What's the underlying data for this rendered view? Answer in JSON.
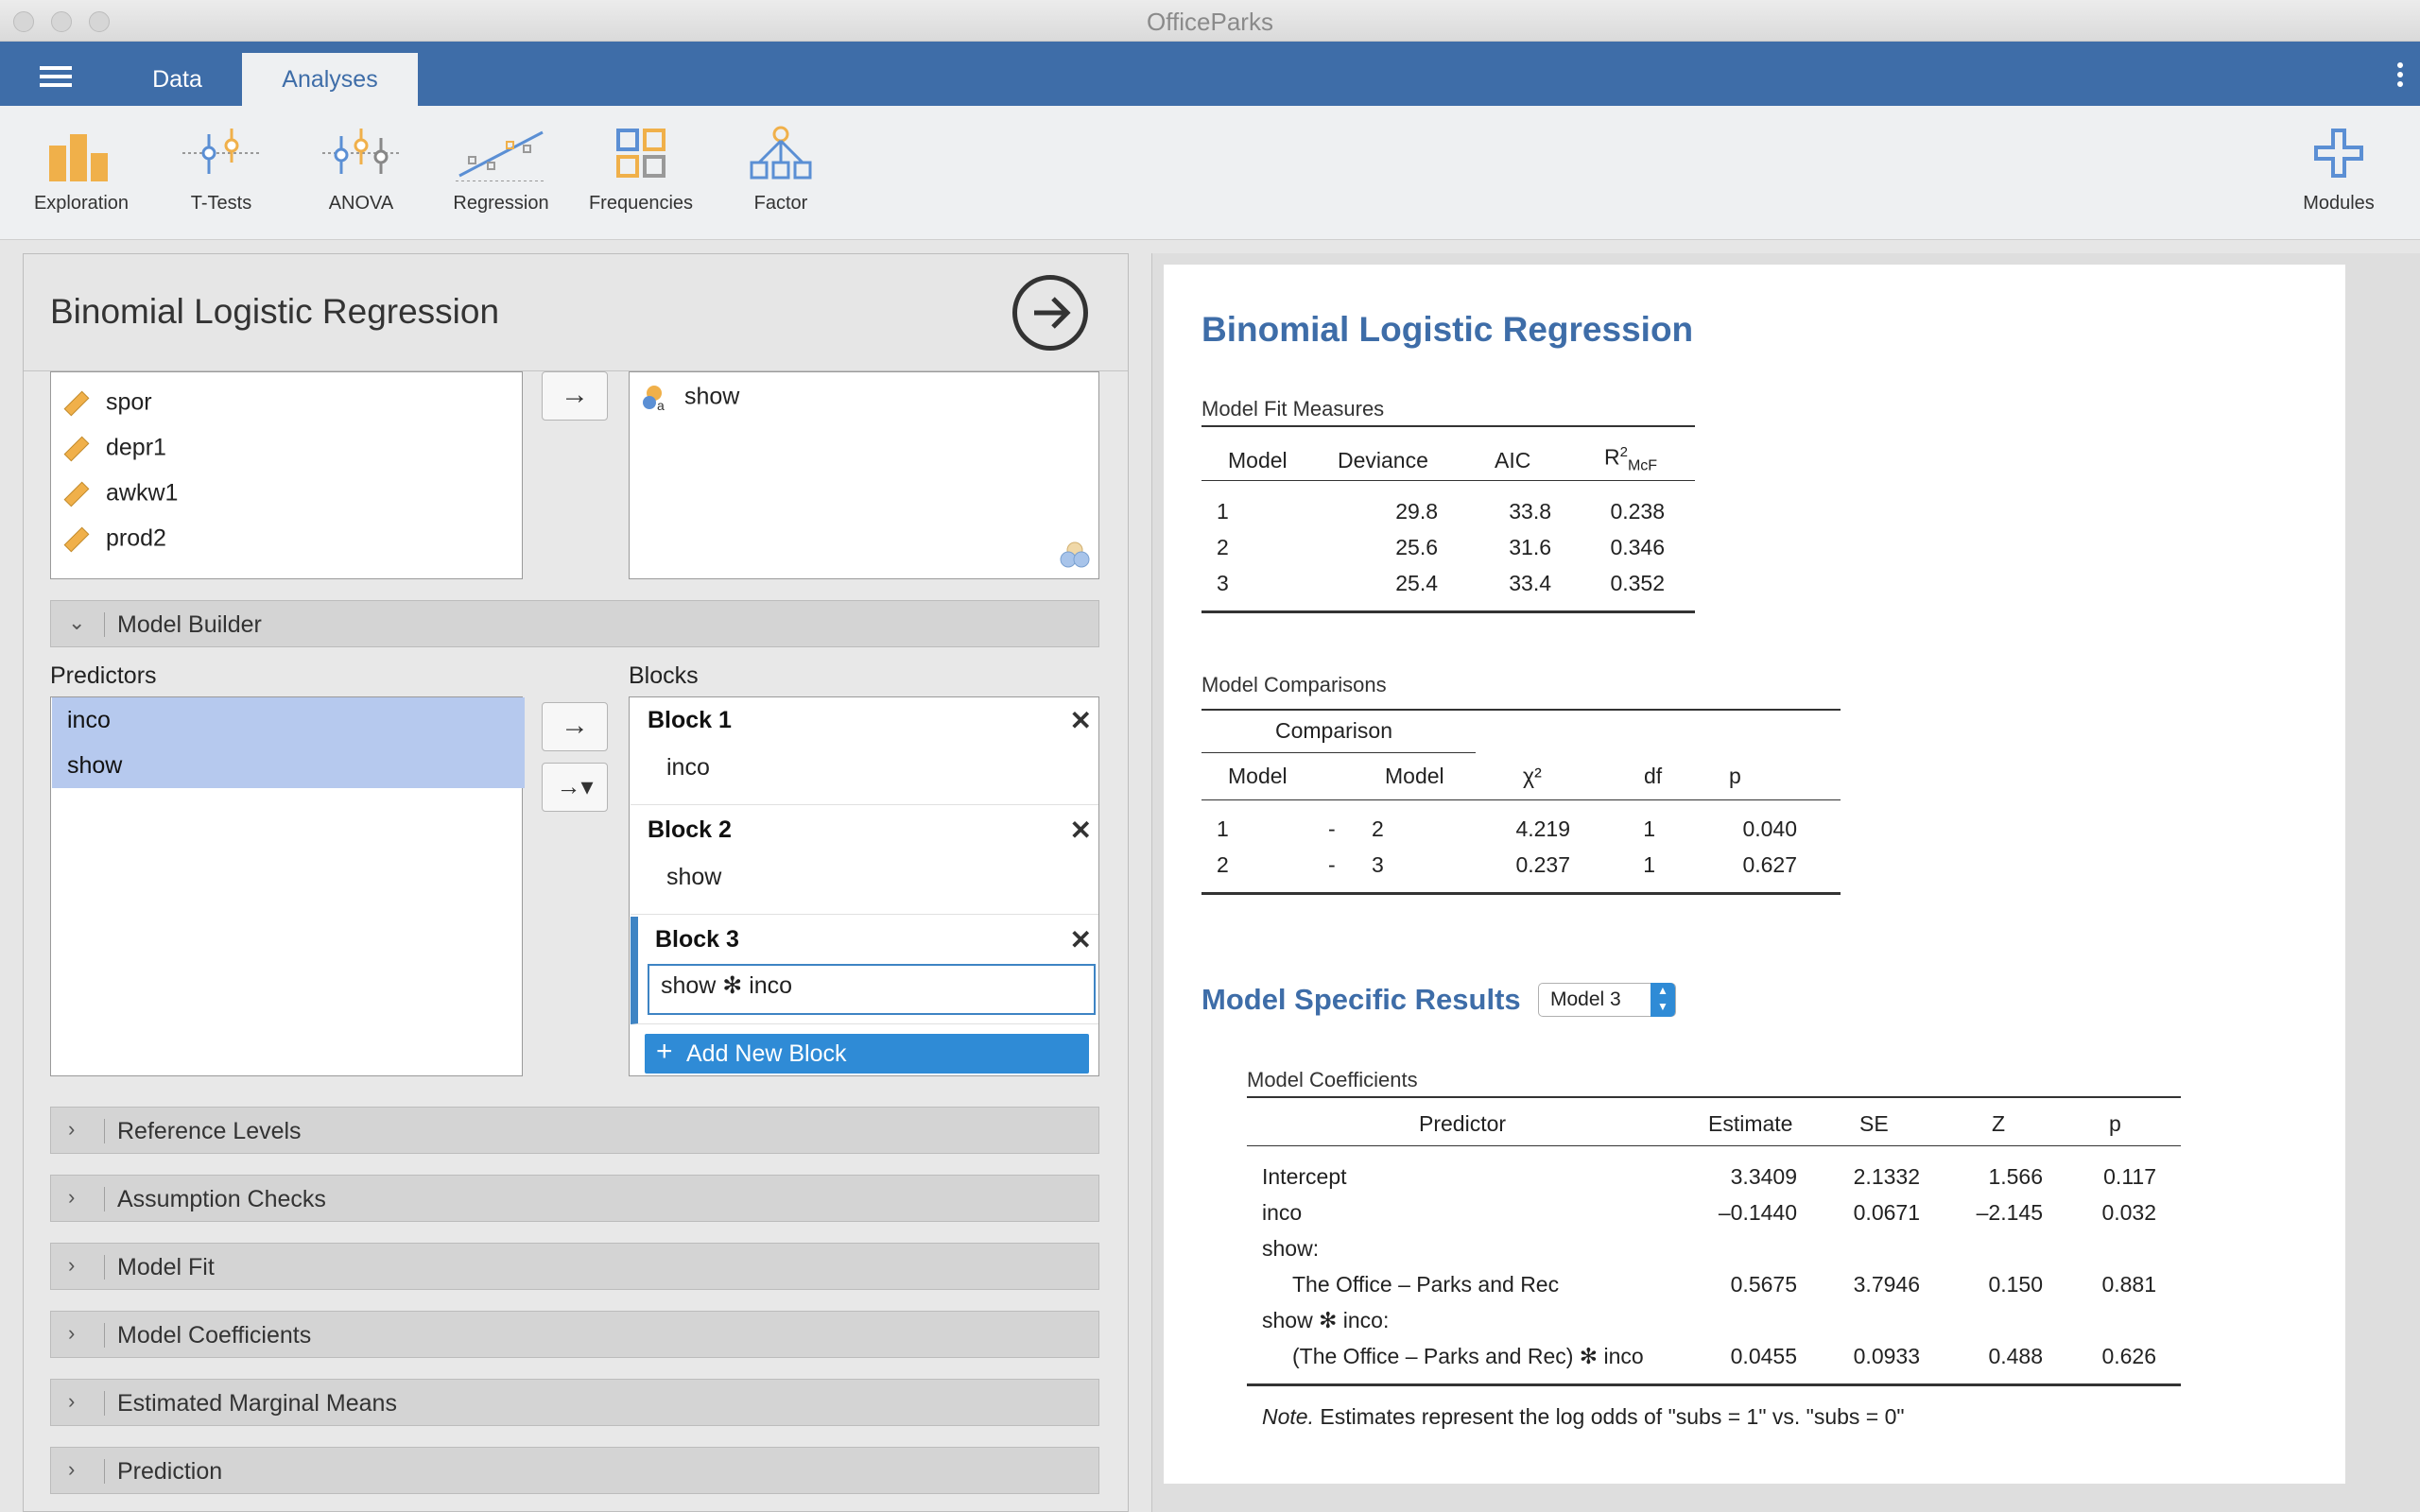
{
  "window": {
    "title": "OfficeParks"
  },
  "tabs": [
    {
      "label": "Data"
    },
    {
      "label": "Analyses"
    }
  ],
  "ribbon": [
    {
      "label": "Exploration",
      "icon": "exploration-icon"
    },
    {
      "label": "T-Tests",
      "icon": "t-tests-icon"
    },
    {
      "label": "ANOVA",
      "icon": "anova-icon"
    },
    {
      "label": "Regression",
      "icon": "regression-icon"
    },
    {
      "label": "Frequencies",
      "icon": "frequencies-icon"
    },
    {
      "label": "Factor",
      "icon": "factor-icon"
    },
    {
      "label": "Modules",
      "icon": "plus-icon"
    }
  ],
  "colors": {
    "accent": "#3e6da8",
    "ribbon_orange": "#f0b04a",
    "ribbon_blue": "#5b8fd4",
    "select_blue": "#2f8bd6",
    "selection": "#b6c9ee"
  },
  "analysis": {
    "title": "Binomial Logistic Regression",
    "variables": [
      "spor",
      "depr1",
      "awkw1",
      "prod2"
    ],
    "factors_box": [
      "show"
    ],
    "model_builder": {
      "label": "Model Builder",
      "predictors_label": "Predictors",
      "predictors": [
        "inco",
        "show"
      ],
      "blocks_label": "Blocks",
      "blocks": [
        {
          "title": "Block 1",
          "value": "inco"
        },
        {
          "title": "Block 2",
          "value": "show"
        },
        {
          "title": "Block 3",
          "value": "show ✻ inco"
        }
      ],
      "add_block": "Add New Block"
    },
    "sections": [
      "Reference Levels",
      "Assumption Checks",
      "Model Fit",
      "Model Coefficients",
      "Estimated Marginal Means",
      "Prediction"
    ]
  },
  "results": {
    "title": "Binomial Logistic Regression",
    "fit": {
      "caption": "Model Fit Measures",
      "headers": [
        "Model",
        "Deviance",
        "AIC",
        "R",
        "2",
        "McF"
      ],
      "rows": [
        [
          "1",
          "29.8",
          "33.8",
          "0.238"
        ],
        [
          "2",
          "25.6",
          "31.6",
          "0.346"
        ],
        [
          "3",
          "25.4",
          "33.4",
          "0.352"
        ]
      ]
    },
    "comparisons": {
      "caption": "Model Comparisons",
      "group": "Comparison",
      "headers": [
        "Model",
        "Model",
        "χ²",
        "df",
        "p"
      ],
      "rows": [
        [
          "1",
          "-",
          "2",
          "4.219",
          "1",
          "0.040"
        ],
        [
          "2",
          "-",
          "3",
          "0.237",
          "1",
          "0.627"
        ]
      ]
    },
    "specific": {
      "title": "Model Specific Results",
      "selected": "Model 3"
    },
    "coefficients": {
      "caption": "Model Coefficients",
      "headers": [
        "Predictor",
        "Estimate",
        "SE",
        "Z",
        "p"
      ],
      "rows": [
        [
          "Intercept",
          "3.3409",
          "2.1332",
          "1.566",
          "0.117"
        ],
        [
          "inco",
          "–0.1440",
          "0.0671",
          "–2.145",
          "0.032"
        ],
        [
          "show:",
          "",
          "",
          "",
          ""
        ],
        [
          "The Office – Parks and Rec",
          "0.5675",
          "3.7946",
          "0.150",
          "0.881"
        ],
        [
          "show ✻ inco:",
          "",
          "",
          "",
          ""
        ],
        [
          "(The Office – Parks and Rec) ✻ inco",
          "0.0455",
          "0.0933",
          "0.488",
          "0.626"
        ]
      ],
      "note_label": "Note.",
      "note": "Estimates represent the log odds of \"subs = 1\" vs. \"subs = 0\""
    }
  }
}
